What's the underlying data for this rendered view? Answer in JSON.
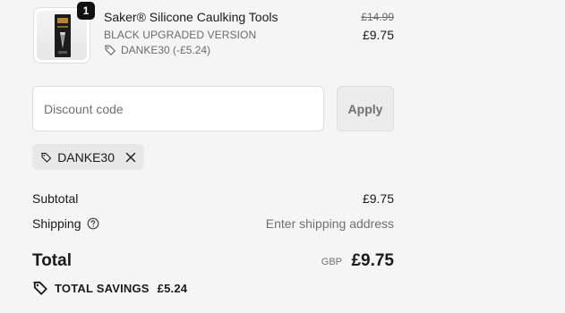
{
  "product": {
    "quantity": "1",
    "title": "Saker® Silicone Caulking Tools",
    "variant": "BLACK UPGRADED VERSION",
    "discount_line": "DANKE30 (-£5.24)",
    "original_price": "£14.99",
    "price": "£9.75"
  },
  "discount": {
    "placeholder": "Discount code",
    "apply_label": "Apply",
    "applied_code": "DANKE30"
  },
  "summary": {
    "subtotal_label": "Subtotal",
    "subtotal_value": "£9.75",
    "shipping_label": "Shipping",
    "shipping_value": "Enter shipping address",
    "total_label": "Total",
    "currency": "GBP",
    "total_value": "£9.75",
    "savings_label": "TOTAL SAVINGS",
    "savings_value": "£5.24"
  },
  "icons": {
    "tag": "tag-icon",
    "close": "close-icon",
    "help": "help-circle-icon"
  }
}
